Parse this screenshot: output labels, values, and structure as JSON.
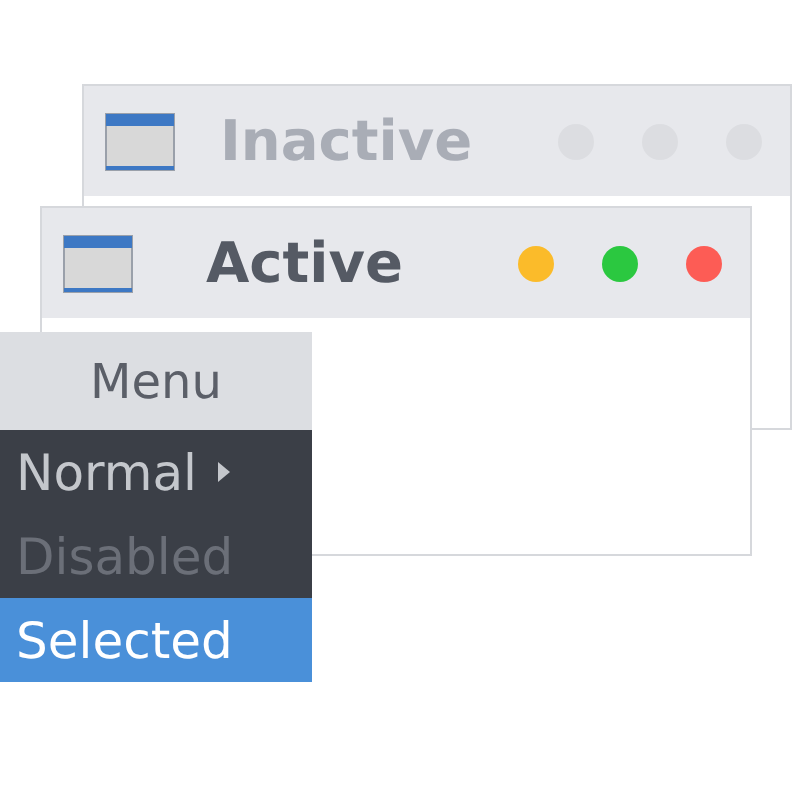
{
  "windows": [
    {
      "title": "Inactive",
      "active": false
    },
    {
      "title": "Active",
      "active": true
    }
  ],
  "menu": {
    "title": "Menu",
    "items": [
      {
        "label": "Normal",
        "has_submenu": true,
        "disabled": false,
        "selected": false
      },
      {
        "label": "Disabled",
        "has_submenu": false,
        "disabled": true,
        "selected": false
      },
      {
        "label": "Selected",
        "has_submenu": false,
        "disabled": false,
        "selected": true
      }
    ]
  }
}
